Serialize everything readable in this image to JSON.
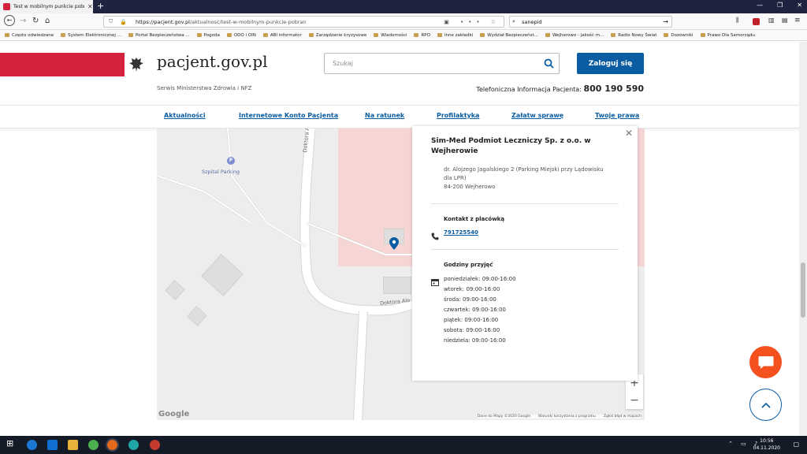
{
  "browser": {
    "tab_title": "Test w mobilnym punkcie pobr",
    "url_prefix": "https://pacjent.gov.pl",
    "url_path": "/aktualnosc/test-w-mobilnym-punkcie-pobran",
    "search_value": "sanepid",
    "bookmarks": [
      "Często odwiedzane",
      "System Elektronicznej ...",
      "Portal Bezpieczeństwa ...",
      "Pogoda",
      "ODO i OIN",
      "ABI informator",
      "Zarządzanie kryzysowe",
      "Wiadomości",
      "RPO",
      "Inne zakładki",
      "Wydział Bezpieczeńst...",
      "Wejherowo - jakość m...",
      "Radio Nowy Świat",
      "Dozowniki",
      "Prawo Dla Samorządu"
    ]
  },
  "header": {
    "logo": "pacjent.gov.pl",
    "subtitle": "Serwis Ministerstwa Zdrowia i NFZ",
    "search_placeholder": "Szukaj",
    "login_label": "Zaloguj się",
    "hotline_label": "Telefoniczna Informacja Pacjenta:",
    "hotline_number": "800 190 590"
  },
  "nav": [
    "Aktualności",
    "Internetowe Konto Pacjenta",
    "Na ratunek",
    "Profilaktyka",
    "Załatw sprawę",
    "Twoje prawa"
  ],
  "map": {
    "labels": [
      "Szpital Parking",
      "Doktora Alojzego",
      "Doktora Alo"
    ],
    "google": "Google",
    "footer": [
      "Dane do Mapy ©2020 Google",
      "Warunki korzystania z programu",
      "Zgłoś błąd w mapach"
    ]
  },
  "facility": {
    "name": "Sim-Med Podmiot Leczniczy Sp. z o.o. w Wejherowie",
    "address_line1": "dr. Alojzego Jagalskiego 2 (Parking Miejski przy Lądowisku dla LPR)",
    "address_line2": "84-200 Wejherowo",
    "contact_label": "Kontakt z placówką",
    "phone": "791725540",
    "hours_label": "Godziny przyjęć",
    "hours": [
      {
        "day": "poniedziałek:",
        "time": "09:00-16:00"
      },
      {
        "day": "wtorek:",
        "time": "09:00-16:00"
      },
      {
        "day": "środa:",
        "time": "09:00-16:00"
      },
      {
        "day": "czwartek:",
        "time": "09:00-16:00"
      },
      {
        "day": "piątek:",
        "time": "09:00-16:00"
      },
      {
        "day": "sobota:",
        "time": "09:00-16:00"
      },
      {
        "day": "niedziela:",
        "time": "09:00-16:00"
      }
    ]
  },
  "taskbar": {
    "time": "10:56",
    "date": "04.11.2020"
  },
  "colors": {
    "brand_red": "#d4213d",
    "brand_blue": "#0a5da3",
    "chat_orange": "#f4511e"
  }
}
